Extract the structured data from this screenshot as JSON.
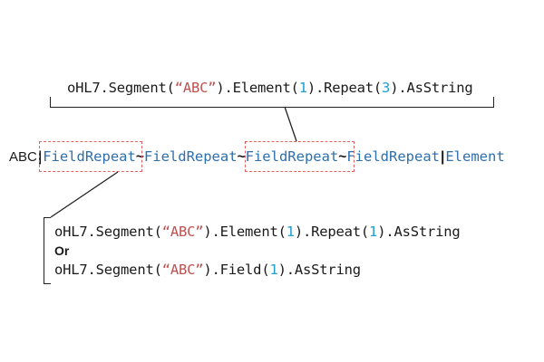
{
  "top_code": {
    "p1": "oHL7.Segment(",
    "s1": "“ABC”",
    "p2": ").Element(",
    "n1": "1",
    "p3": ").Repeat(",
    "n2": "3",
    "p4": ").AsString"
  },
  "segment": {
    "name": "ABC",
    "pipe": "|",
    "tilde": "~",
    "field_repeat": "FieldRepeat",
    "element": "Element"
  },
  "bottom_code": {
    "line1": {
      "p1": "oHL7.Segment(",
      "s1": "“ABC”",
      "p2": ").Element(",
      "n1": "1",
      "p3": ").Repeat(",
      "n2": "1",
      "p4": ").AsString"
    },
    "or_label": "Or",
    "line3": {
      "p1": "oHL7.Segment(",
      "s1": "“ABC”",
      "p2": ").Field(",
      "n1": "1",
      "p3": ").AsString"
    }
  },
  "colors": {
    "string": "#c0504d",
    "number": "#1f9fd6",
    "keyword": "#2e6fad",
    "dash_box": "#e06060"
  }
}
